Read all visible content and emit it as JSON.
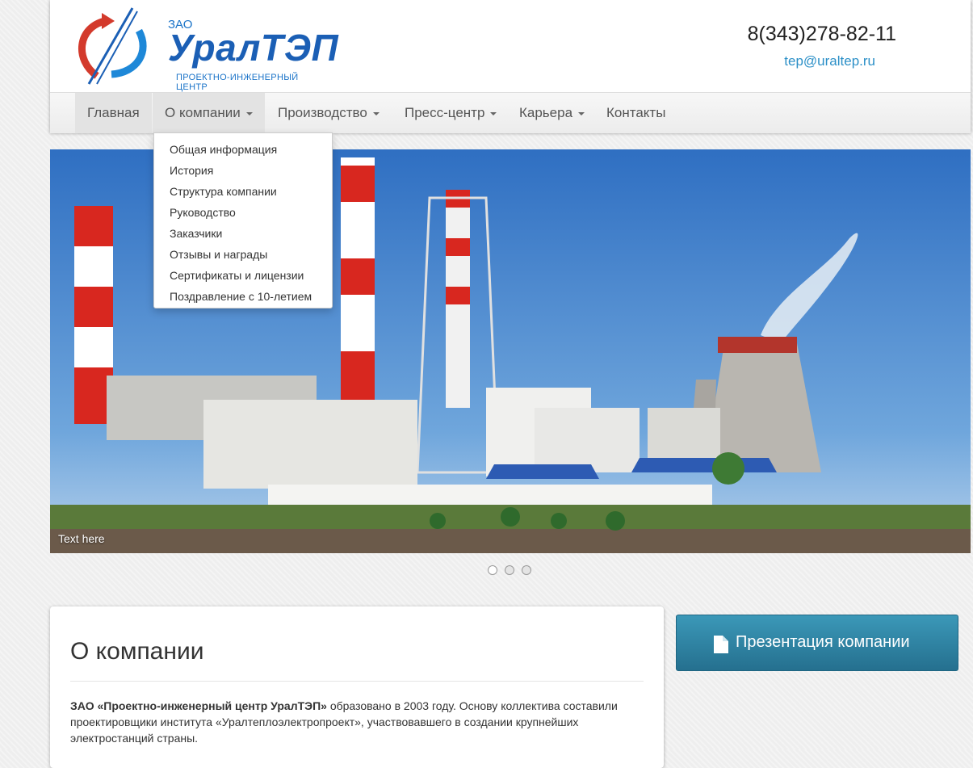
{
  "header": {
    "logo": {
      "prefix": "ЗАО",
      "name": "УралТЭП",
      "subtitle": "ПРОЕКТНО-ИНЖЕНЕРНЫЙ ЦЕНТР"
    },
    "phone": "8(343)278-82-11",
    "email": "tep@uraltep.ru"
  },
  "nav": {
    "items": [
      {
        "label": "Главная",
        "has_caret": false,
        "active": true
      },
      {
        "label": "О компании",
        "has_caret": true,
        "open": true
      },
      {
        "label": "Производство",
        "has_caret": true
      },
      {
        "label": "Пресс-центр",
        "has_caret": true
      },
      {
        "label": "Карьера",
        "has_caret": true
      },
      {
        "label": "Контакты",
        "has_caret": false
      }
    ],
    "dropdown": [
      "Общая информация",
      "История",
      "Структура компании",
      "Руководство",
      "Заказчики",
      "Отзывы и награды",
      "Сертификаты и лицензии",
      "Поздравление с 10-летием"
    ]
  },
  "carousel": {
    "caption": "Text here",
    "slide_count": 3,
    "active_index": 0
  },
  "about": {
    "title": "О компании",
    "intro_bold": "ЗАО «Проектно-инженерный центр УралТЭП»",
    "intro_text": " образовано в 2003 году. Основу коллектива составили проектировщики института «Уралтеплоэлектропроект», участвовавшего в создании крупнейших электростанций страны."
  },
  "presentation_button": {
    "label": "Презентация компании",
    "icon": "document-icon"
  },
  "colors": {
    "brand_blue": "#1b5fb5",
    "brand_red": "#d33a2c",
    "link": "#2b8fc7",
    "button": "#2f86a6"
  }
}
